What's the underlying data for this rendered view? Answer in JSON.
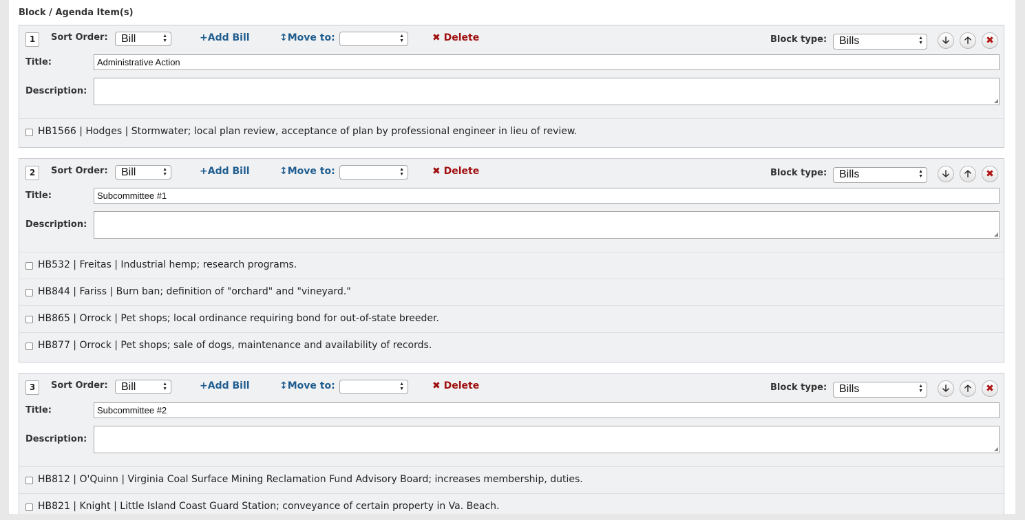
{
  "section_title": "Block / Agenda Item(s)",
  "labels": {
    "sort_order": "Sort Order:",
    "add_bill": "Add Bill",
    "move_to": "Move to:",
    "delete": "Delete",
    "block_type": "Block type:",
    "title": "Title:",
    "description": "Description:"
  },
  "icons": {
    "add": "plus-icon",
    "move": "vertical-arrows-icon",
    "delete": "x-icon",
    "down": "arrow-down-icon",
    "up": "arrow-up-icon",
    "remove": "close-circle-icon"
  },
  "colors": {
    "link": "#1f5d8f",
    "danger": "#a01010"
  },
  "blocks": [
    {
      "number": "1",
      "sort_order": "Bill",
      "move_to": "",
      "block_type": "Bills",
      "title": "Administrative Action",
      "description": "",
      "items": [
        "HB1566 | Hodges | Stormwater; local plan review, acceptance of plan by professional engineer in lieu of review."
      ]
    },
    {
      "number": "2",
      "sort_order": "Bill",
      "move_to": "",
      "block_type": "Bills",
      "title": "Subcommittee #1",
      "description": "",
      "items": [
        "HB532 | Freitas | Industrial hemp; research programs.",
        "HB844 | Fariss | Burn ban; definition of \"orchard\" and \"vineyard.\"",
        "HB865 | Orrock | Pet shops; local ordinance requiring bond for out-of-state breeder.",
        "HB877 | Orrock | Pet shops; sale of dogs, maintenance and availability of records."
      ]
    },
    {
      "number": "3",
      "sort_order": "Bill",
      "move_to": "",
      "block_type": "Bills",
      "title": "Subcommittee #2",
      "description": "",
      "items": [
        "HB812 | O'Quinn | Virginia Coal Surface Mining Reclamation Fund Advisory Board; increases membership, duties.",
        "HB821 | Knight | Little Island Coast Guard Station; conveyance of certain property in Va. Beach."
      ]
    }
  ]
}
